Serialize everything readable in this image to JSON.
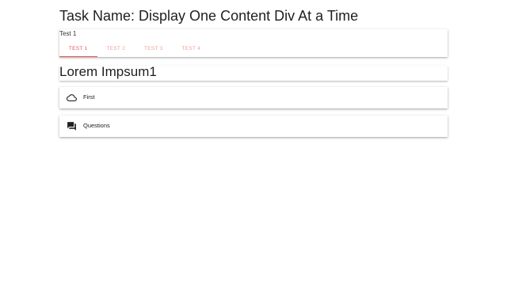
{
  "task_title": "Task Name: Display One Content Div At a Time",
  "tabs_card": {
    "title": "Test 1",
    "tabs": [
      {
        "label": "TEST 1",
        "active": true
      },
      {
        "label": "TEST 2",
        "active": false
      },
      {
        "label": "TEST 3",
        "active": false
      },
      {
        "label": "TEST 4",
        "active": false
      }
    ]
  },
  "content": {
    "heading": "Lorem Impsum1",
    "items": [
      {
        "label": "First",
        "icon": "cloud-icon"
      },
      {
        "label": "Questions",
        "icon": "forum-icon"
      }
    ]
  },
  "colors": {
    "accent": "#ef5350",
    "tab_inactive": "#f2a19b"
  }
}
